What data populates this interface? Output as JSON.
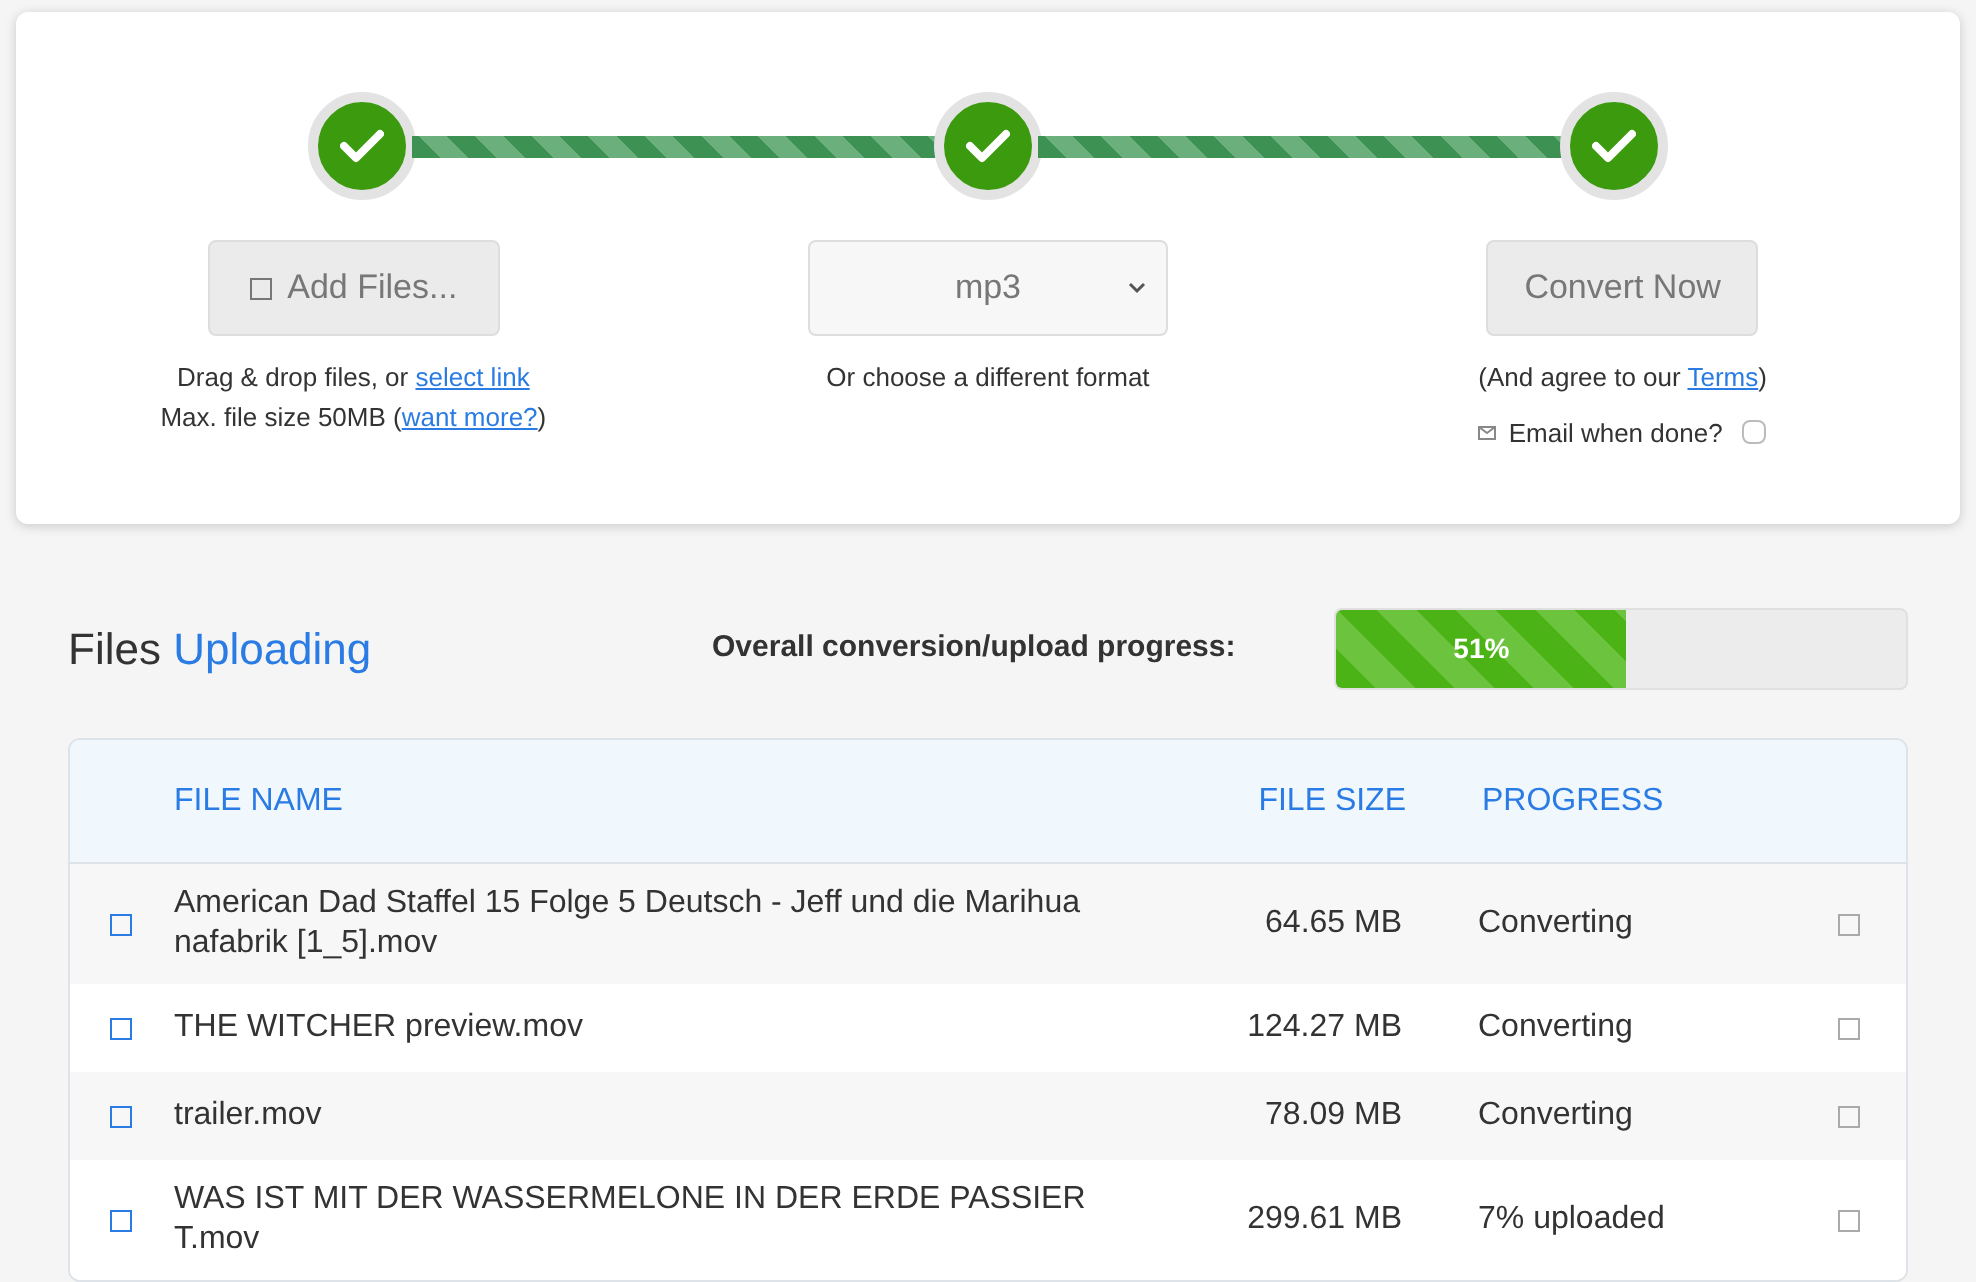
{
  "steps": [
    {
      "done": true
    },
    {
      "done": true
    },
    {
      "done": true
    }
  ],
  "add_files": {
    "label": "Add Files...",
    "hint_1": "Drag & drop files, or ",
    "hint_1_link": "select link",
    "hint_2": "Max. file size 50MB (",
    "hint_2_link": "want more?",
    "hint_2_end": ")"
  },
  "format": {
    "value": "mp3",
    "hint": "Or choose a different format"
  },
  "convert": {
    "label": "Convert Now",
    "hint": "(And agree to our ",
    "hint_link": "Terms",
    "hint_end": ")",
    "email_label": "Email when done?",
    "email_checked": false
  },
  "heading": {
    "title": "Files",
    "status": "Uploading"
  },
  "overall": {
    "label": "Overall conversion/upload progress:",
    "level": 0.51,
    "reading": "51%"
  },
  "table": {
    "columns": [
      "FILE NAME",
      "FILE SIZE",
      "PROGRESS"
    ],
    "rows": [
      {
        "name": "American Dad Staffel 15 Folge 5 Deutsch - Jeff und die Marihuanafabrik [1_5].mov",
        "size": "64.65 MB",
        "progress": "Converting"
      },
      {
        "name": "THE WITCHER preview.mov",
        "size": "124.27 MB",
        "progress": "Converting"
      },
      {
        "name": "trailer.mov",
        "size": "78.09 MB",
        "progress": "Converting"
      },
      {
        "name": "WAS IST MIT DER WASSERMELONE IN DER ERDE PASSIERT.mov",
        "size": "299.61 MB",
        "progress": "7% uploaded"
      }
    ]
  }
}
